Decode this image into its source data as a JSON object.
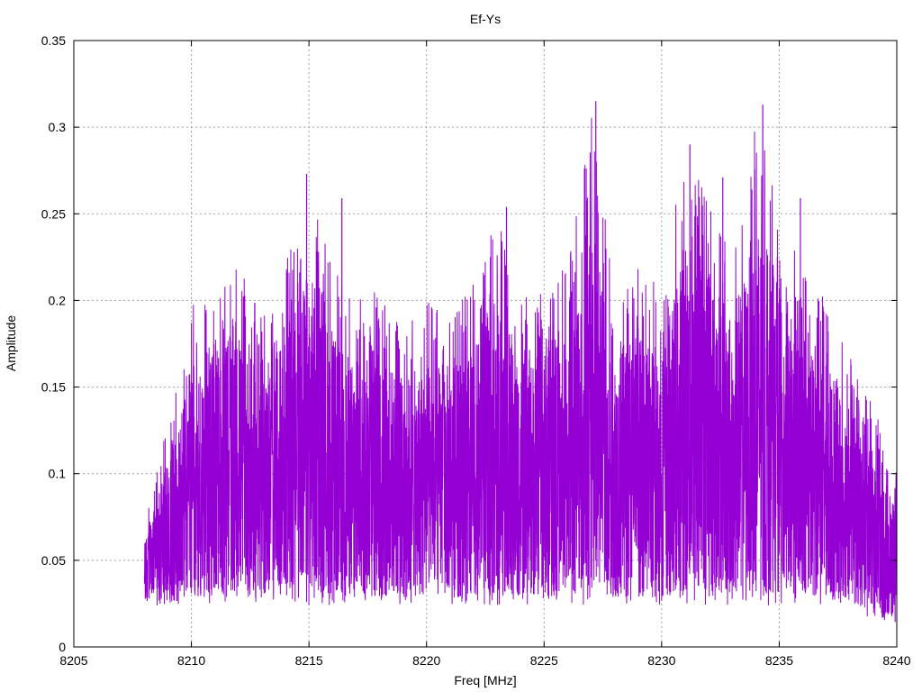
{
  "chart_data": {
    "type": "line",
    "title": "Ef-Ys",
    "xlabel": "Freq [MHz]",
    "ylabel": "Amplitude",
    "xlim": [
      8205,
      8240
    ],
    "ylim": [
      0,
      0.35
    ],
    "xticks": [
      8205,
      8210,
      8215,
      8220,
      8225,
      8230,
      8235,
      8240
    ],
    "yticks": [
      0,
      0.05,
      0.1,
      0.15,
      0.2,
      0.25,
      0.3,
      0.35
    ],
    "xtick_labels": [
      "8205",
      "8210",
      "8215",
      "8220",
      "8225",
      "8230",
      "8235",
      "8240"
    ],
    "ytick_labels": [
      "0",
      "0.05",
      "0.1",
      "0.15",
      "0.2",
      "0.25",
      "0.3",
      "0.35"
    ],
    "grid": true,
    "line_color": "#9400d3",
    "series": [
      {
        "x_start": 8208.0,
        "x_end": 8240.0,
        "envelope_x": [
          8208.0,
          8209.0,
          8210.0,
          8211.0,
          8212.0,
          8213.0,
          8214.0,
          8215.0,
          8216.0,
          8217.0,
          8218.0,
          8219.0,
          8220.0,
          8221.0,
          8222.0,
          8223.0,
          8224.0,
          8225.0,
          8226.0,
          8227.0,
          8228.0,
          8229.0,
          8230.0,
          8231.0,
          8232.0,
          8233.0,
          8234.0,
          8235.0,
          8236.0,
          8237.0,
          8238.0,
          8239.0,
          8240.0
        ],
        "envelope_high": [
          0.07,
          0.13,
          0.2,
          0.21,
          0.22,
          0.19,
          0.22,
          0.27,
          0.22,
          0.2,
          0.21,
          0.19,
          0.2,
          0.2,
          0.21,
          0.25,
          0.2,
          0.21,
          0.22,
          0.31,
          0.21,
          0.22,
          0.21,
          0.29,
          0.27,
          0.22,
          0.31,
          0.25,
          0.22,
          0.2,
          0.17,
          0.14,
          0.1
        ],
        "envelope_low": [
          0.02,
          0.02,
          0.02,
          0.02,
          0.02,
          0.02,
          0.02,
          0.02,
          0.02,
          0.02,
          0.02,
          0.02,
          0.02,
          0.02,
          0.02,
          0.02,
          0.02,
          0.02,
          0.02,
          0.02,
          0.02,
          0.02,
          0.02,
          0.02,
          0.02,
          0.02,
          0.02,
          0.02,
          0.02,
          0.02,
          0.02,
          0.01,
          0.01
        ],
        "peaks": [
          {
            "x": 8214.9,
            "y": 0.273
          },
          {
            "x": 8216.4,
            "y": 0.259
          },
          {
            "x": 8223.4,
            "y": 0.254
          },
          {
            "x": 8227.2,
            "y": 0.315
          },
          {
            "x": 8231.2,
            "y": 0.29
          },
          {
            "x": 8232.6,
            "y": 0.271
          },
          {
            "x": 8234.3,
            "y": 0.313
          },
          {
            "x": 8235.9,
            "y": 0.259
          }
        ]
      }
    ]
  }
}
